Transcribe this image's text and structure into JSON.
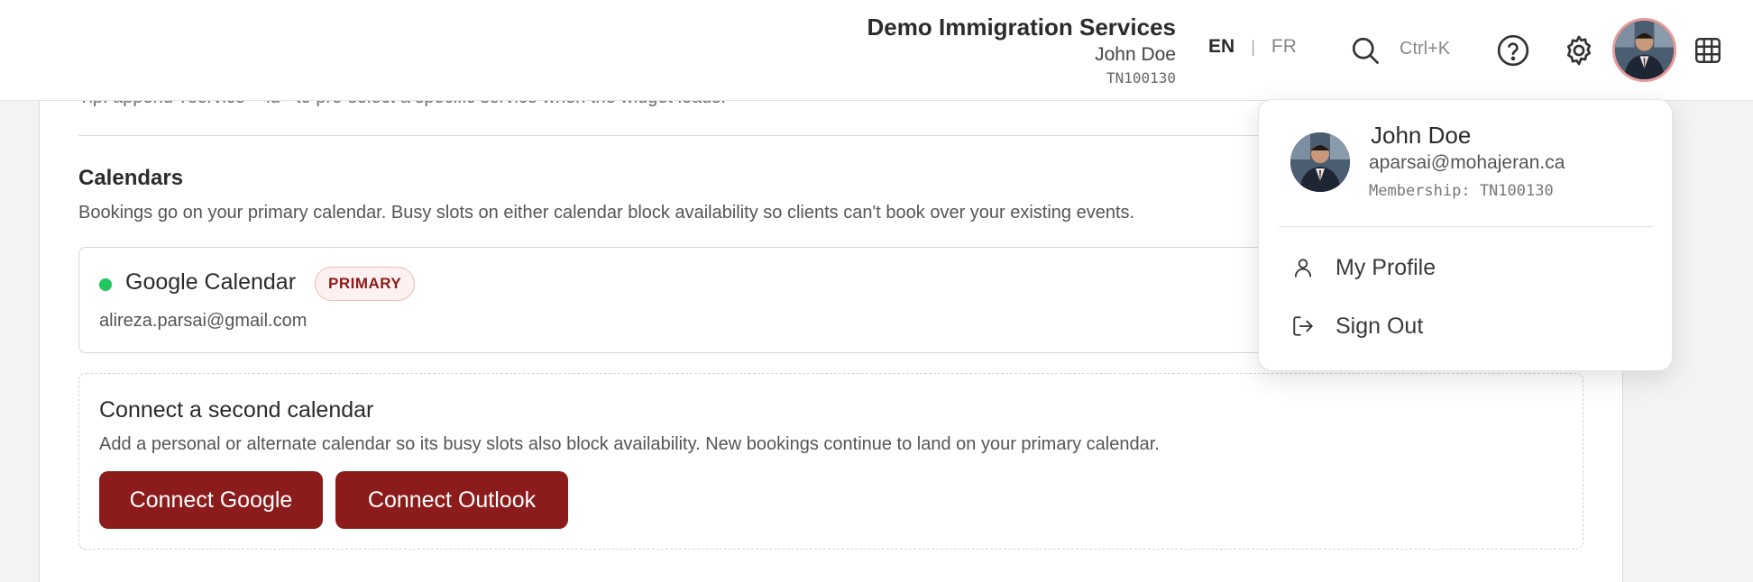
{
  "header": {
    "org_name": "Demo Immigration Services",
    "user_name": "John Doe",
    "user_id": "TN100130",
    "lang_en": "EN",
    "lang_sep": "|",
    "lang_fr": "FR",
    "search_shortcut": "Ctrl+K"
  },
  "main": {
    "tip_text": "Tip: append ?service=<id> to pre-select a specific service when the widget loads.",
    "calendars_title": "Calendars",
    "calendars_desc": "Bookings go on your primary calendar. Busy slots on either calendar block availability so clients can't book over your existing events.",
    "google_calendar": {
      "name": "Google Calendar",
      "badge": "PRIMARY",
      "email": "alireza.parsai@gmail.com",
      "status_color": "#22c55e"
    },
    "second_calendar": {
      "title": "Connect a second calendar",
      "desc": "Add a personal or alternate calendar so its busy slots also block availability. New bookings continue to land on your primary calendar.",
      "connect_google": "Connect Google",
      "connect_outlook": "Connect Outlook"
    }
  },
  "dropdown": {
    "name": "John Doe",
    "email": "aparsai@mohajeran.ca",
    "membership": "Membership: TN100130",
    "my_profile": "My Profile",
    "sign_out": "Sign Out"
  },
  "colors": {
    "brand": "#8c1b1b",
    "avatar_ring": "#e79a9a"
  }
}
